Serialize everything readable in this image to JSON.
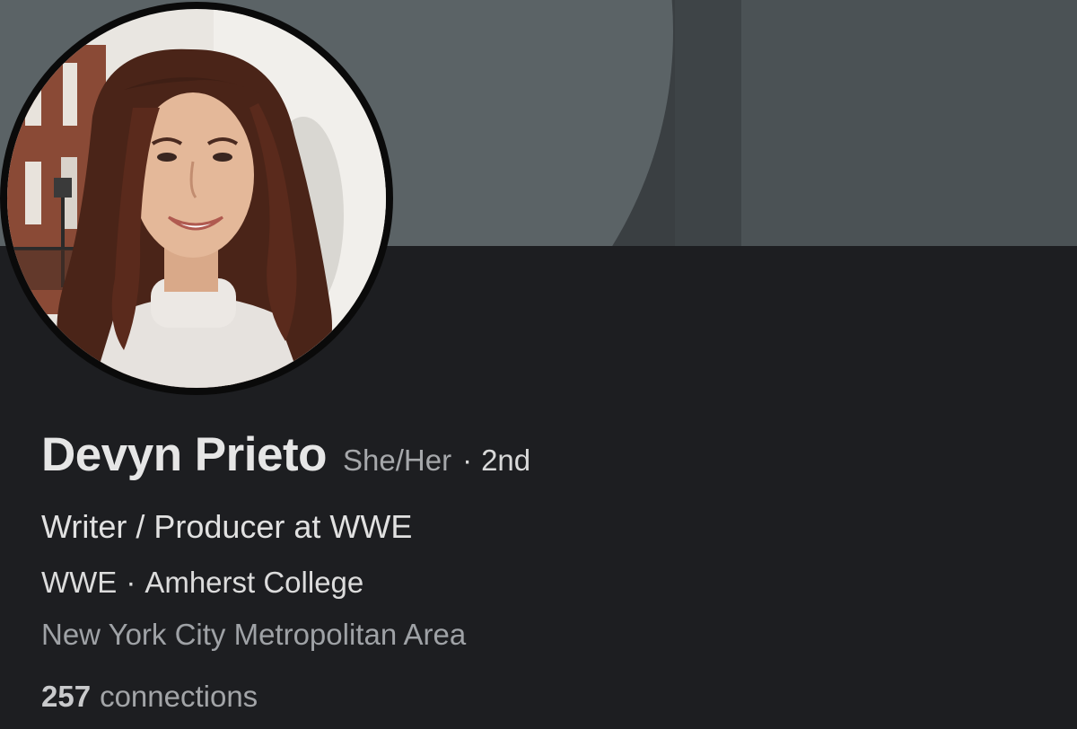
{
  "profile": {
    "name": "Devyn Prieto",
    "pronouns": "She/Her",
    "separator": "·",
    "degree": "2nd",
    "headline": "Writer / Producer at WWE",
    "company": "WWE",
    "school": "Amherst College",
    "location": "New York City Metropolitan Area",
    "connections_count": "257",
    "connections_label": "connections"
  },
  "colors": {
    "background": "#1d1e21",
    "banner_light": "#5b6366",
    "banner_dark": "#3a3f42",
    "banner_right": "#4b5255",
    "avatar_ring": "#0a0a0a"
  }
}
